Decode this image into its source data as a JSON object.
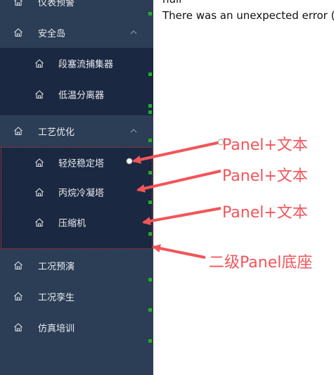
{
  "sidebar": {
    "items": [
      {
        "label": "仪表预警"
      },
      {
        "label": "安全岛",
        "children": [
          "段塞流捕集器",
          "低温分离器"
        ]
      },
      {
        "label": "工艺优化",
        "children": [
          "轻烃稳定塔",
          "丙烷冷凝塔",
          "压缩机"
        ]
      },
      {
        "label": "工况预演"
      },
      {
        "label": "工况孪生"
      },
      {
        "label": "仿真培训"
      }
    ]
  },
  "main": {
    "line1": "null",
    "line2": "There was an unexpected error ("
  },
  "annotations": {
    "a1": "Panel+文本",
    "a2": "Panel+文本",
    "a3": "Panel+文本",
    "a4": "二级Panel底座"
  },
  "colors": {
    "sidebar_bg": "#2c3e55",
    "submenu_bg": "#1b2841",
    "annotation": "#f2555a",
    "indicator": "#1db02c"
  }
}
